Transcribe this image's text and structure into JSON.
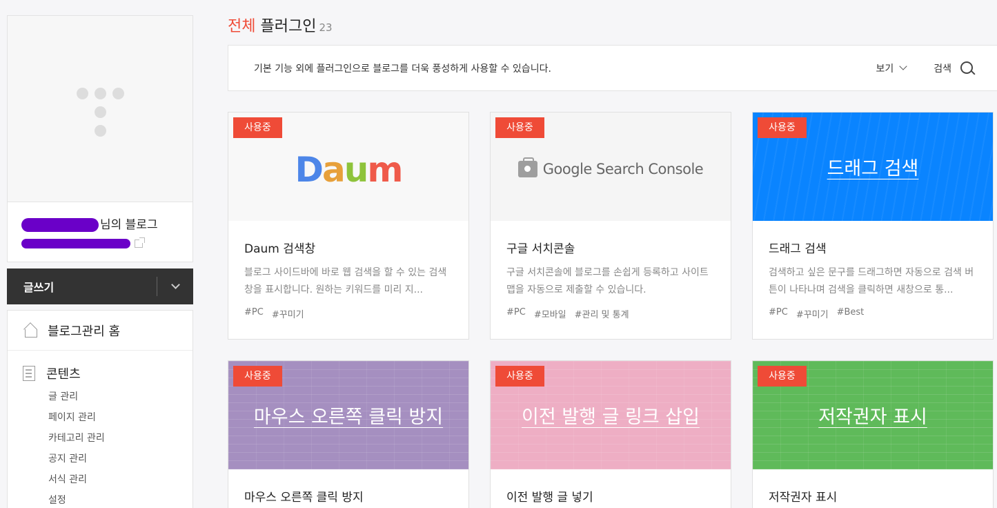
{
  "sidebar": {
    "blog_name_suffix": "님의 블로그",
    "write_label": "글쓰기",
    "home_label": "블로그관리 홈",
    "content_label": "콘텐츠",
    "content_items": [
      "글 관리",
      "페이지 관리",
      "카테고리 관리",
      "공지 관리",
      "서식 관리",
      "설정"
    ]
  },
  "header": {
    "title_accent": "전체",
    "title_main": "플러그인",
    "count": "23"
  },
  "info_bar": {
    "description": "기본 기능 외에 플러그인으로 블로그를 더욱 풍성하게 사용할 수 있습니다.",
    "view_label": "보기",
    "search_label": "검색"
  },
  "colors": {
    "accent": "#ef4b37",
    "drag_blue": "#0a84ff",
    "mouse_purple": "#a58fc0",
    "prev_pink": "#eeaec4",
    "copyright_green": "#5fba5a"
  },
  "cards": [
    {
      "badge": "사용중",
      "logo": "Daum",
      "name": "Daum 검색창",
      "desc": "블로그 사이드바에 바로 웹 검색을 할 수 있는 검색창을 표시합니다. 원하는 키워드를 미리 지...",
      "tags": [
        "#PC",
        "#꾸미기"
      ]
    },
    {
      "badge": "사용중",
      "logo": "Google Search Console",
      "name": "구글 서치콘솔",
      "desc": "구글 서치콘솔에 블로그를 손쉽게 등록하고 사이트맵을 자동으로 제출할 수 있습니다.",
      "tags": [
        "#PC",
        "#모바일",
        "#관리 및 통계"
      ]
    },
    {
      "badge": "사용중",
      "thumb_title": "드래그 검색",
      "name": "드래그 검색",
      "desc": "검색하고 싶은 문구를 드래그하면 자동으로 검색 버튼이 나타나며 검색을 클릭하면 새창으로 통...",
      "tags": [
        "#PC",
        "#꾸미기",
        "#Best"
      ]
    },
    {
      "badge": "사용중",
      "thumb_title": "마우스 오른쪽 클릭 방지",
      "name": "마우스 오른쪽 클릭 방지"
    },
    {
      "badge": "사용중",
      "thumb_title": "이전 발행 글 링크 삽입",
      "name": "이전 발행 글 넣기"
    },
    {
      "badge": "사용중",
      "thumb_title": "저작권자 표시",
      "name": "저작권자 표시"
    }
  ]
}
